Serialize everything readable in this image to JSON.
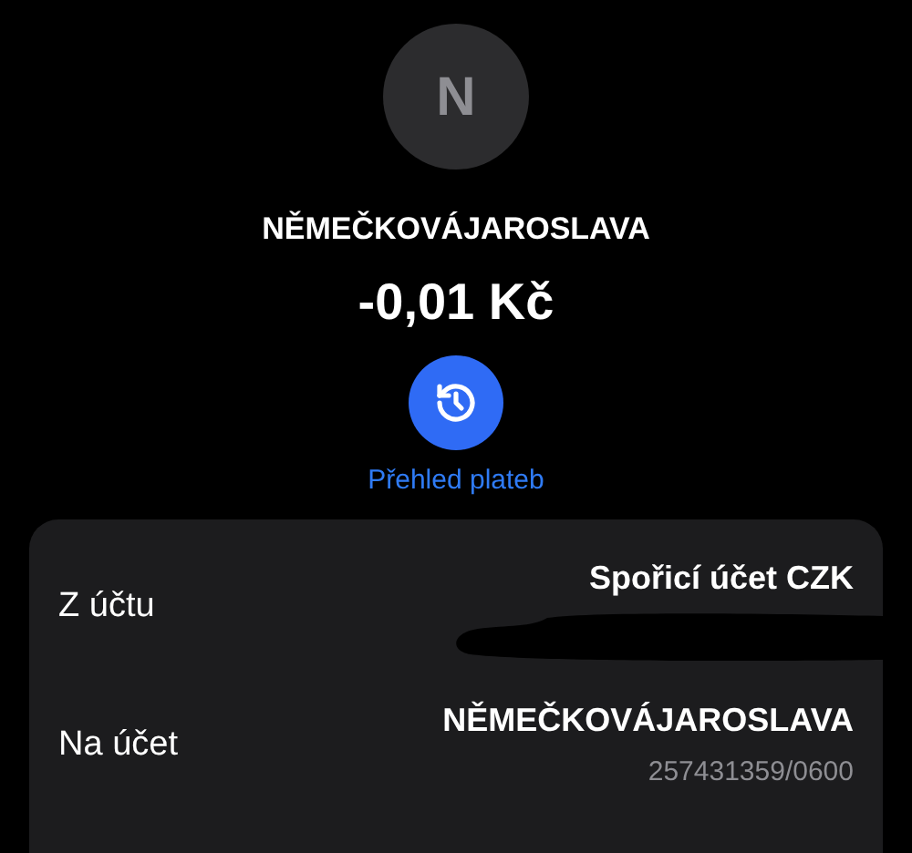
{
  "avatar": {
    "initial": "N"
  },
  "counterparty": "NĚMEČKOVÁJAROSLAVA",
  "amount": "-0,01 Kč",
  "history_link": "Přehled plateb",
  "details": [
    {
      "label": "Z účtu",
      "title": "Spořicí účet CZK",
      "redacted": true
    },
    {
      "label": "Na účet",
      "title": "NĚMEČKOVÁJAROSLAVA",
      "subtitle": "257431359/0600"
    }
  ]
}
